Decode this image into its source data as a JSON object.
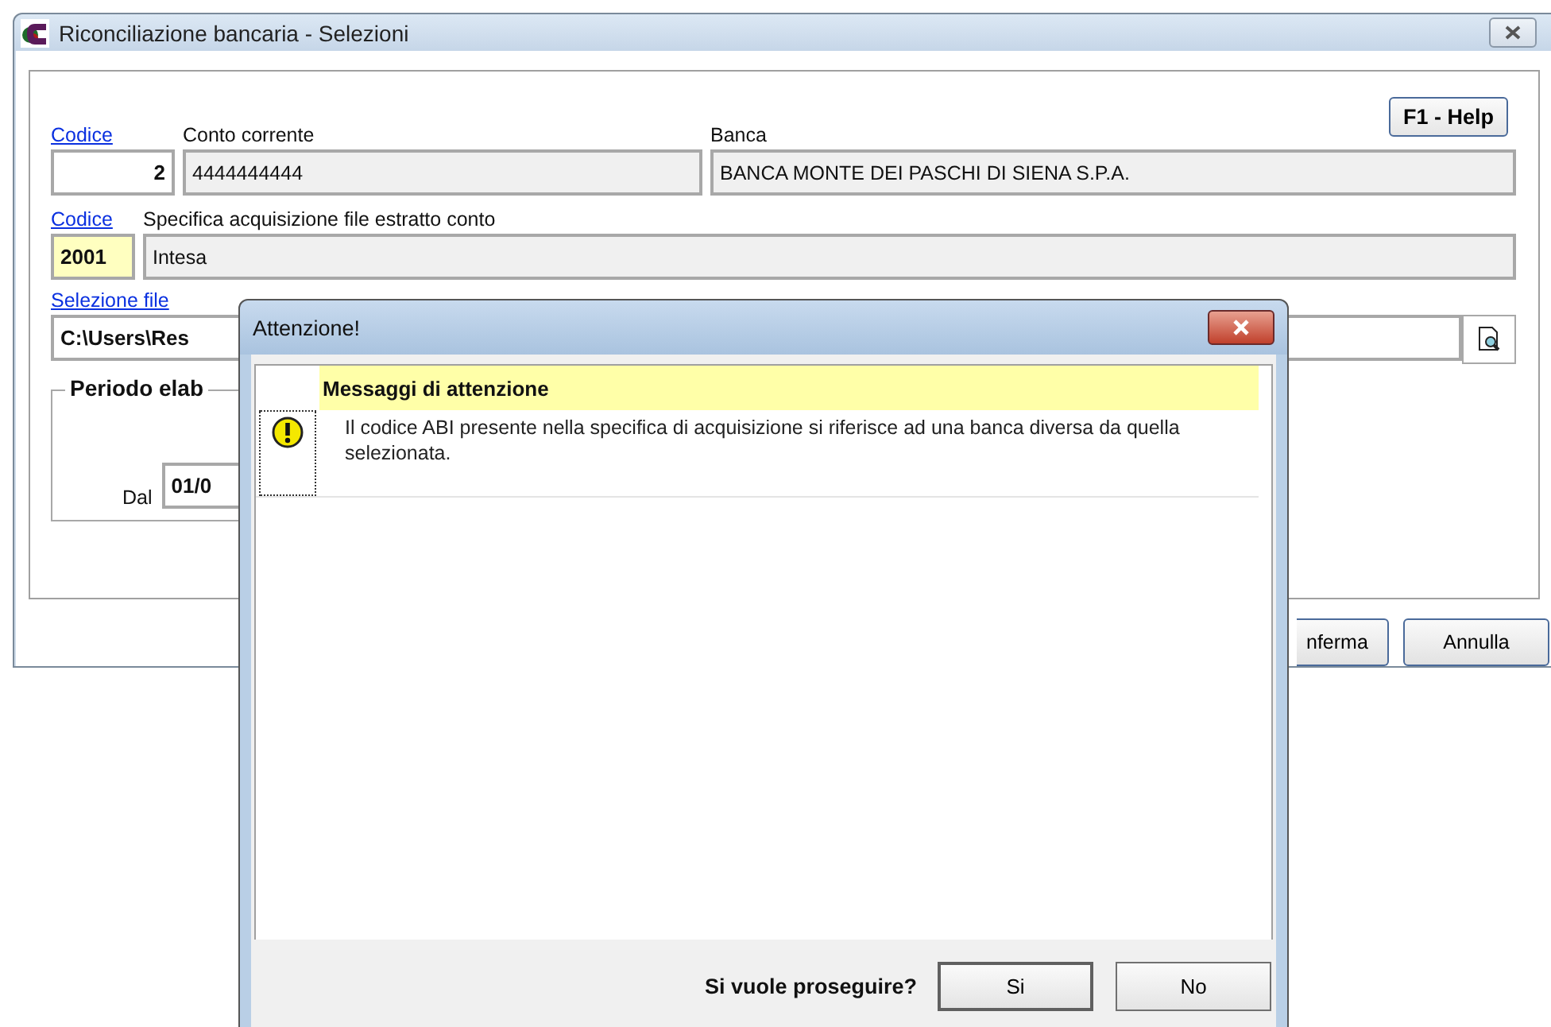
{
  "window": {
    "title": "Riconciliazione bancaria - Selezioni"
  },
  "help_button": "F1 - Help",
  "account": {
    "link": "Codice",
    "code": "2",
    "number_label": "Conto corrente",
    "number": "4444444444",
    "bank_label": "Banca",
    "bank": "BANCA MONTE DEI PASCHI DI SIENA S.P.A."
  },
  "spec": {
    "link": "Codice",
    "label": "Specifica acquisizione file estratto conto",
    "code": "2001",
    "name": "Intesa"
  },
  "file": {
    "link": "Selezione file",
    "path": "C:\\Users\\Res"
  },
  "period": {
    "title": "Periodo elab",
    "from_label": "Dal",
    "from": "01/0"
  },
  "buttons": [
    "nferma",
    "Annulla"
  ],
  "dialog": {
    "title": "Attenzione!",
    "header": "Messaggi di attenzione",
    "messages": [
      {
        "kind": "warning",
        "text": "Il codice ABI presente nella specifica di acquisizione si riferisce ad una banca diversa da quella selezionata."
      }
    ],
    "question": "Si vuole proseguire?",
    "buttons": [
      "Si",
      "No"
    ]
  }
}
